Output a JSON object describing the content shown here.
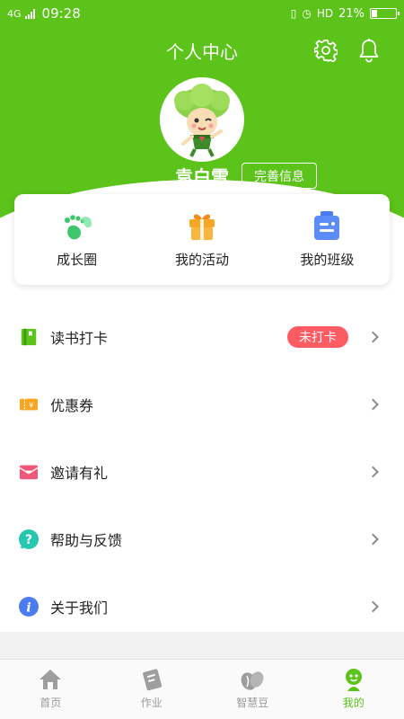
{
  "status_bar": {
    "network": "4G",
    "time": "09:28",
    "hd": "HD",
    "battery": "21%",
    "battery_level": 0.21
  },
  "header": {
    "title": "个人中心",
    "username": "袁白雪",
    "edit_label": "完善信息",
    "color": "#5cc31a"
  },
  "quick_actions": [
    {
      "label": "成长圈",
      "icon": "footprint-icon",
      "color": "#3ec66d"
    },
    {
      "label": "我的活动",
      "icon": "gift-icon",
      "color": "#f6a623"
    },
    {
      "label": "我的班级",
      "icon": "class-icon",
      "color": "#4a7cf0"
    }
  ],
  "menu": [
    {
      "label": "读书打卡",
      "icon": "book-icon",
      "badge": "未打卡"
    },
    {
      "label": "优惠券",
      "icon": "coupon-icon"
    },
    {
      "label": "邀请有礼",
      "icon": "invite-icon"
    },
    {
      "label": "帮助与反馈",
      "icon": "help-icon"
    },
    {
      "label": "关于我们",
      "icon": "info-icon"
    }
  ],
  "bottom_nav": [
    {
      "label": "首页",
      "icon": "home-icon"
    },
    {
      "label": "作业",
      "icon": "homework-icon"
    },
    {
      "label": "智慧豆",
      "icon": "bean-icon"
    },
    {
      "label": "我的",
      "icon": "profile-icon",
      "active": true
    }
  ],
  "colors": {
    "accent": "#5cc31a",
    "badge": "#ff5b63"
  }
}
